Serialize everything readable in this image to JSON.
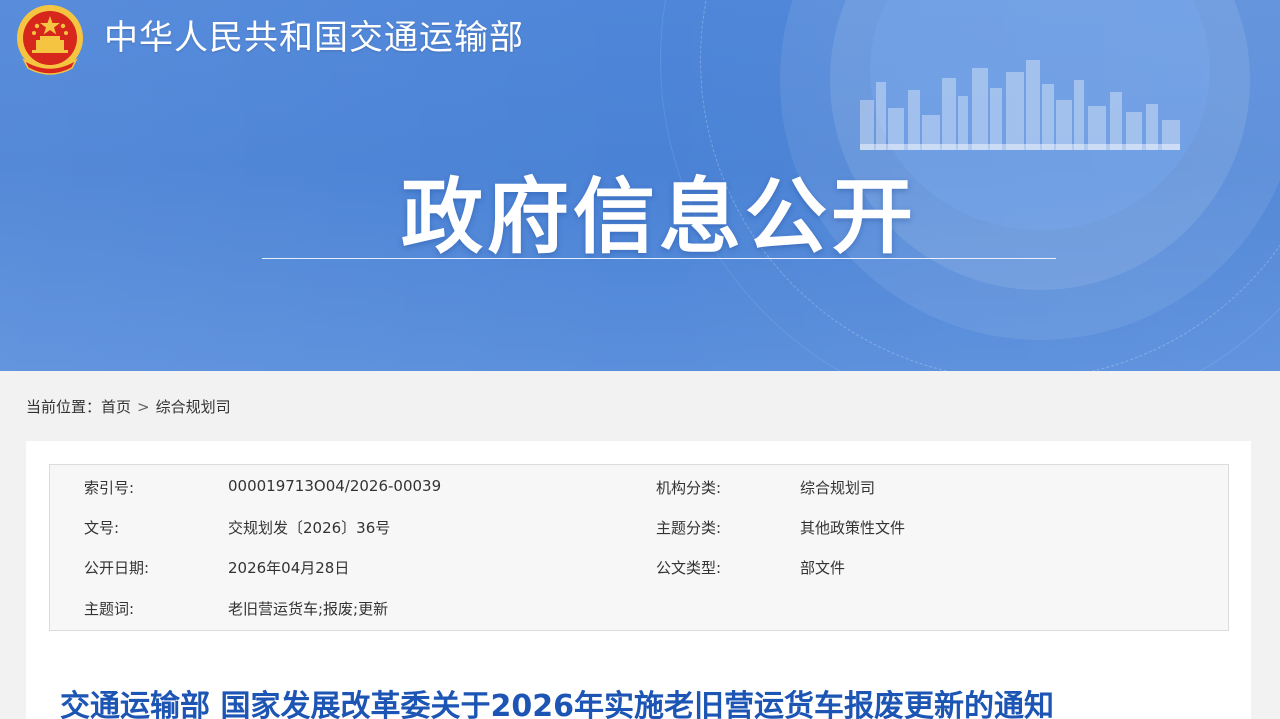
{
  "header": {
    "ministry_name": "中华人民共和国交通运输部",
    "banner_title": "政府信息公开"
  },
  "breadcrumb": {
    "prefix": "当前位置：",
    "items": [
      "首页",
      "综合规划司"
    ],
    "separator": ">"
  },
  "metadata": {
    "rows": [
      {
        "label1": "索引号:",
        "value1": "000019713O04/2026-00039",
        "label2": "机构分类:",
        "value2": "综合规划司"
      },
      {
        "label1": "文号:",
        "value1": "交规划发〔2026〕36号",
        "label2": "主题分类:",
        "value2": "其他政策性文件"
      },
      {
        "label1": "公开日期:",
        "value1": "2026年04月28日",
        "label2": "公文类型:",
        "value2": "部文件"
      },
      {
        "label1": "主题词:",
        "value1": "老旧营运货车;报废;更新",
        "label2": "",
        "value2": ""
      }
    ]
  },
  "document": {
    "title": "交通运输部 国家发展改革委关于2026年实施老旧营运货车报废更新的通知"
  },
  "colors": {
    "banner_blue": "#4a82d5",
    "title_blue": "#1d55b4",
    "emblem_red": "#d7261b",
    "emblem_gold": "#f5c542"
  },
  "icons": {
    "emblem": "national-emblem-icon",
    "skyline": "city-skyline-graphic"
  }
}
